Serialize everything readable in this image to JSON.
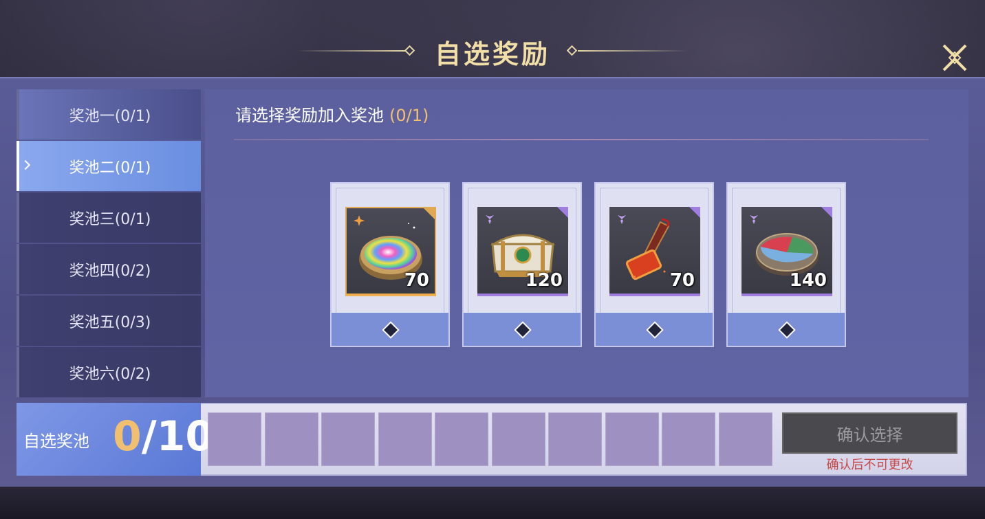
{
  "header": {
    "title": "自选奖励",
    "close_icon": "close-x-icon"
  },
  "sidebar": {
    "active_index": 1,
    "items": [
      {
        "label": "奖池一(0/1)"
      },
      {
        "label": "奖池二(0/1)"
      },
      {
        "label": "奖池三(0/1)"
      },
      {
        "label": "奖池四(0/2)"
      },
      {
        "label": "奖池五(0/3)"
      },
      {
        "label": "奖池六(0/2)"
      }
    ]
  },
  "content": {
    "prompt": "请选择奖励加入奖池",
    "prompt_count": "(0/1)",
    "items": [
      {
        "icon": "rainbow-bowl-icon",
        "qty": "70",
        "rarity": "orange",
        "rarity_icon": "orange-star-icon"
      },
      {
        "icon": "treasure-chest-icon",
        "qty": "120",
        "rarity": "purple",
        "rarity_icon": "purple-trefoil-icon"
      },
      {
        "icon": "fire-hammer-icon",
        "qty": "70",
        "rarity": "purple",
        "rarity_icon": "purple-trefoil-icon"
      },
      {
        "icon": "tricolor-disc-icon",
        "qty": "140",
        "rarity": "purple",
        "rarity_icon": "purple-trefoil-icon"
      }
    ]
  },
  "bottom": {
    "pool_label": "自选奖池",
    "current": "0",
    "separator": "/",
    "total": "10",
    "slot_count": 10,
    "confirm_label": "确认选择",
    "confirm_note": "确认后不可更改"
  },
  "colors": {
    "accent_gold": "#f0c070",
    "active_tab": "#7b9ce8",
    "purple_rarity": "#a07ee0",
    "orange_rarity": "#e0a850",
    "warning_red": "#c84848"
  }
}
